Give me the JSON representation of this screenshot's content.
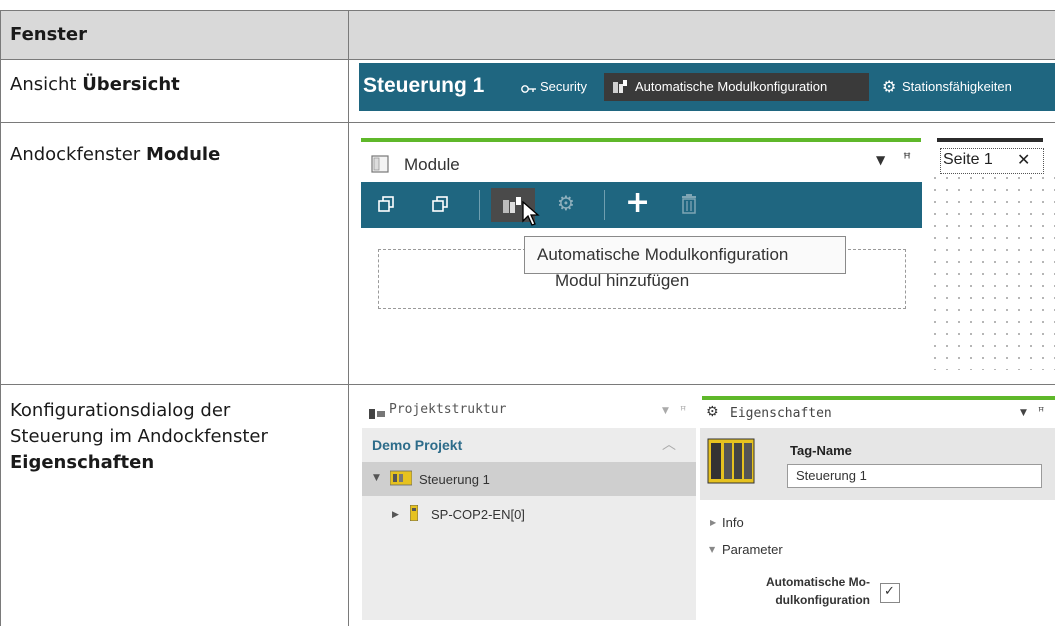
{
  "table": {
    "header": "Fenster",
    "rows": [
      {
        "prefix": "Ansicht ",
        "bold": "Übersicht"
      },
      {
        "prefix": "Andockfenster ",
        "bold": "Module"
      },
      {
        "line1": "Konfigurationsdialog der",
        "line2": "Steuerung im Andockfenster",
        "bold": "Eigenschaften"
      }
    ]
  },
  "overview_toolbar": {
    "title": "Steuerung 1",
    "security_label": "Security",
    "auto_config_label": "Automatische Modulkonfiguration",
    "station_label": "Stationsfähigkeiten"
  },
  "modules_panel": {
    "title": "Module",
    "tooltip": "Automatische Modulkonfiguration",
    "add_module_text": "Modul hinzufügen",
    "page_tab_label": "Seite 1",
    "page_tab_close": "✕"
  },
  "project_structure": {
    "title": "Projektstruktur",
    "project_name": "Demo Projekt",
    "controller": "Steuerung 1",
    "module": "SP-COP2-EN[0]"
  },
  "properties": {
    "title": "Eigenschaften",
    "tag_name_label": "Tag-Name",
    "tag_name_value": "Steuerung 1",
    "info_label": "Info",
    "parameter_label": "Parameter",
    "auto_config_line1": "Automatische Mo-",
    "auto_config_line2": "dulkonfiguration",
    "auto_config_checked": true
  },
  "colors": {
    "toolbar_blue": "#1f6680",
    "accent_green": "#5fb82a",
    "header_gray": "#d9d9d9"
  }
}
